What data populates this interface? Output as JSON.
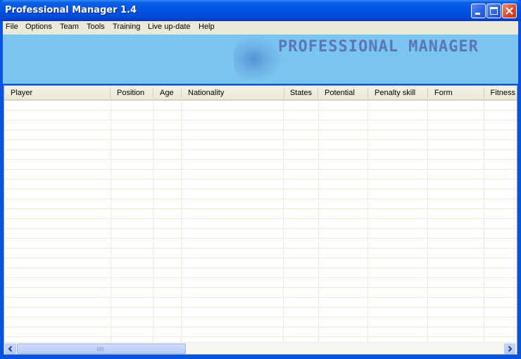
{
  "window": {
    "title": "Professional Manager 1.4",
    "controls": {
      "minimize": "minimize",
      "maximize": "maximize",
      "close": "close"
    }
  },
  "menu": {
    "items": [
      {
        "label": "File"
      },
      {
        "label": "Options"
      },
      {
        "label": "Team"
      },
      {
        "label": "Tools"
      },
      {
        "label": "Training"
      },
      {
        "label": "Live up-date"
      },
      {
        "label": "Help"
      }
    ]
  },
  "banner": {
    "title": "PROFESSIONAL MANAGER"
  },
  "table": {
    "columns": [
      {
        "label": "Player"
      },
      {
        "label": "Position"
      },
      {
        "label": "Age"
      },
      {
        "label": "Nationality"
      },
      {
        "label": "States"
      },
      {
        "label": "Potential"
      },
      {
        "label": "Penalty skill"
      },
      {
        "label": "Form"
      },
      {
        "label": "Fitness"
      }
    ],
    "rows": []
  },
  "colors": {
    "titlebar": "#0055e5",
    "menubar": "#ece9d8",
    "banner": "#7ac4f0",
    "banner_text": "#5a76b8"
  }
}
